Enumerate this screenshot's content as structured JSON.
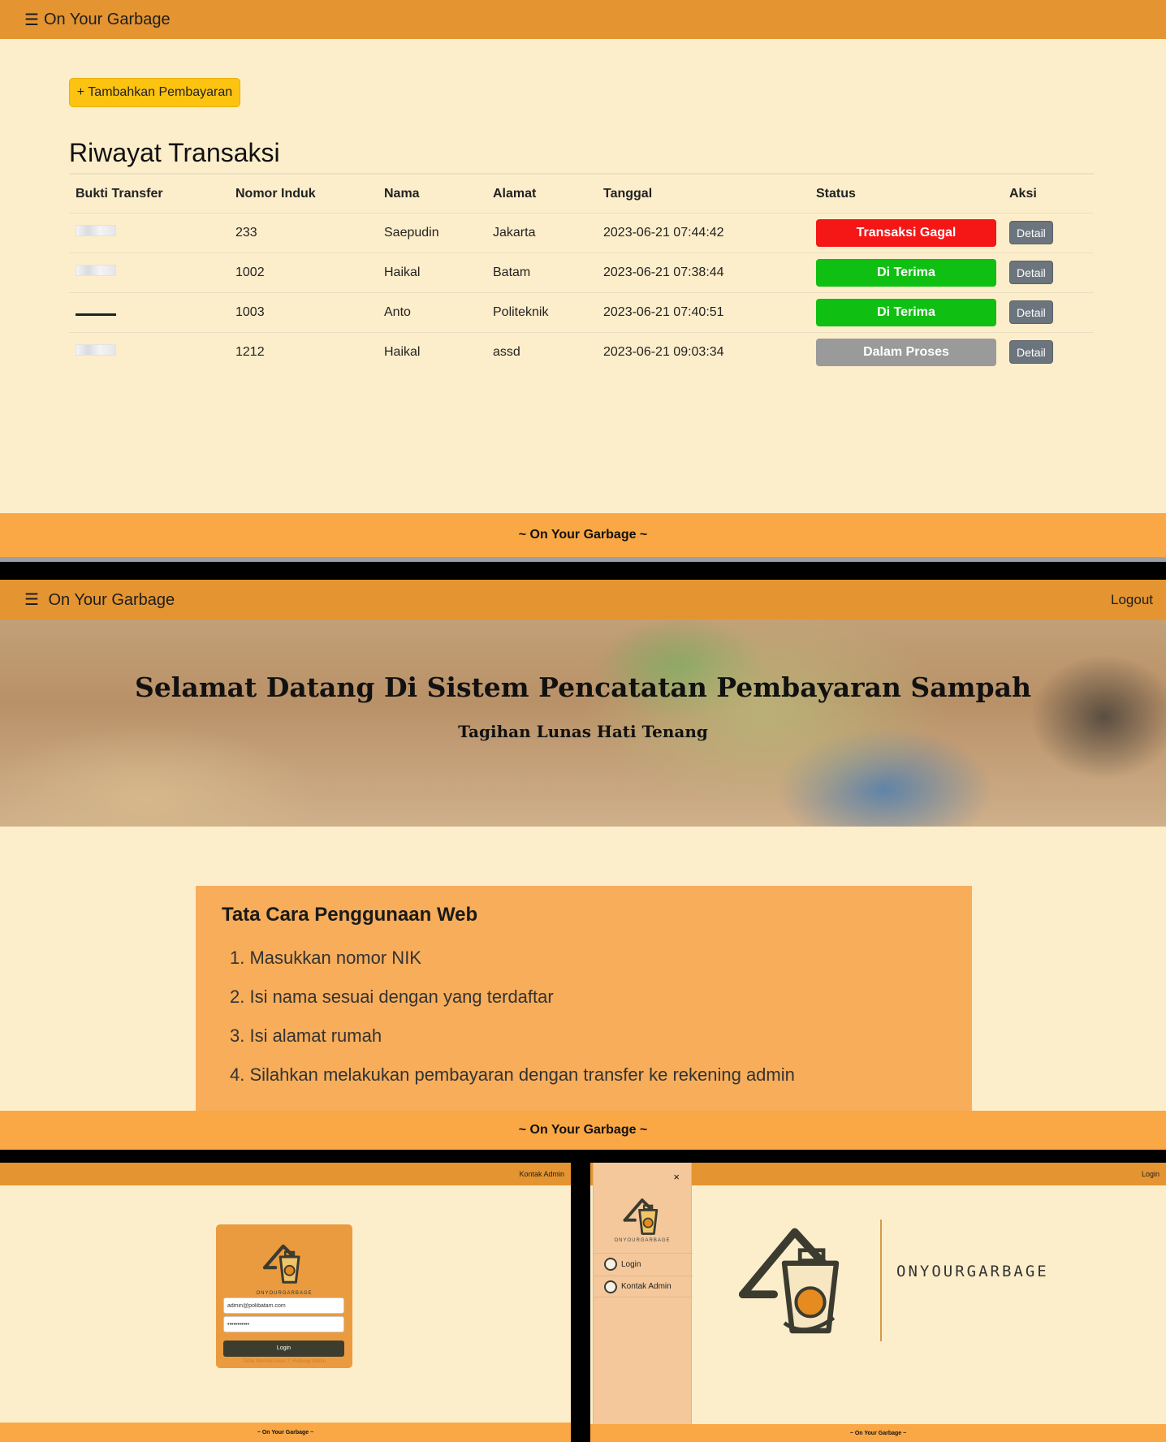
{
  "history_page": {
    "app_title": "On Your Garbage",
    "add_button": "+ Tambahkan Pembayaran",
    "page_title": "Riwayat Transaksi",
    "columns": [
      "Bukti Transfer",
      "Nomor Induk",
      "Nama",
      "Alamat",
      "Tanggal",
      "Status",
      "Aksi"
    ],
    "rows": [
      {
        "nomor_induk": "233",
        "nama": "Saepudin",
        "alamat": "Jakarta",
        "tanggal": "2023-06-21 07:44:42",
        "status": "Transaksi Gagal",
        "status_color": "#f51616",
        "aksi": "Detail"
      },
      {
        "nomor_induk": "1002",
        "nama": "Haikal",
        "alamat": "Batam",
        "tanggal": "2023-06-21 07:38:44",
        "status": "Di Terima",
        "status_color": "#0fbf12",
        "aksi": "Detail"
      },
      {
        "nomor_induk": "1003",
        "nama": "Anto",
        "alamat": "Politeknik",
        "tanggal": "2023-06-21 07:40:51",
        "status": "Di Terima",
        "status_color": "#0fbf12",
        "aksi": "Detail"
      },
      {
        "nomor_induk": "1212",
        "nama": "Haikal",
        "alamat": "assd",
        "tanggal": "2023-06-21 09:03:34",
        "status": "Dalam Proses",
        "status_color": "#9a9a9a",
        "aksi": "Detail"
      }
    ],
    "footer": "~ On Your Garbage ~"
  },
  "home_page": {
    "app_title": "On Your Garbage",
    "logout": "Logout",
    "hero_title": "Selamat Datang Di Sistem Pencatatan Pembayaran Sampah",
    "hero_subtitle": "Tagihan Lunas Hati Tenang",
    "howto_title": "Tata Cara Penggunaan Web",
    "howto_steps": [
      "1. Masukkan nomor NIK",
      "2. Isi nama sesuai dengan yang terdaftar",
      "3. Isi alamat rumah",
      "4. Silahkan melakukan pembayaran dengan transfer ke rekening admin"
    ],
    "footer": "~ On Your Garbage ~"
  },
  "login_page": {
    "topbar_link": "Kontak Admin",
    "brand": "ONYOURGARBAGE",
    "email_value": "admin@polibatam.com",
    "password_value": "•••••••••••",
    "login_button": "Login",
    "hint": "Tidak Memiliki Akun ?, Hubungi Admin",
    "footer": "~ On Your Garbage ~"
  },
  "landing_page": {
    "topbar_link": "Login",
    "close_icon": "×",
    "sidebar_brand": "ONYOURGARBAGE",
    "sidebar_items": [
      "Login",
      "Kontak Admin"
    ],
    "brand": "ONYOURGARBAGE",
    "footer": "~ On Your Garbage ~"
  },
  "colors": {
    "header": "#e49430",
    "background": "#fdeecb",
    "footer": "#faa845",
    "accent": "#fcc310"
  }
}
